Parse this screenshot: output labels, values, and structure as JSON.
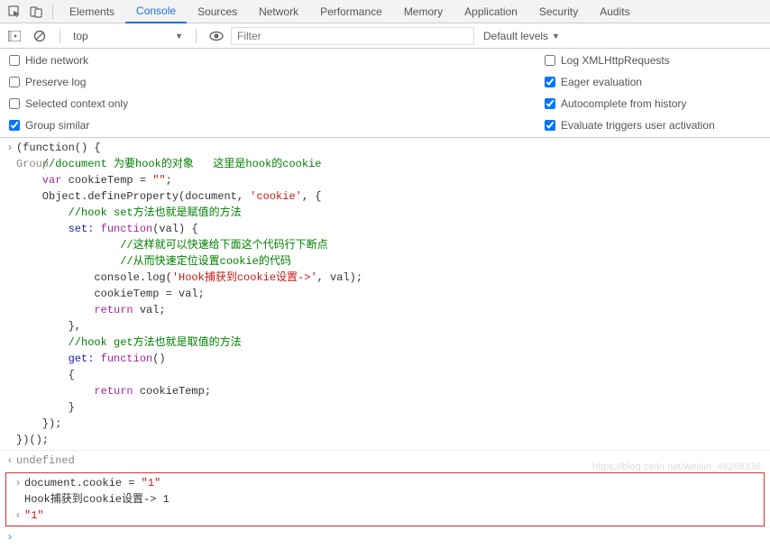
{
  "tabs": {
    "elements": "Elements",
    "console": "Console",
    "sources": "Sources",
    "network": "Network",
    "performance": "Performance",
    "memory": "Memory",
    "application": "Application",
    "security": "Security",
    "audits": "Audits"
  },
  "context": {
    "selected": "top"
  },
  "filter": {
    "placeholder": "Filter"
  },
  "levels": {
    "label": "Default levels"
  },
  "options_left": {
    "hide_network": "Hide network",
    "preserve_log": "Preserve log",
    "selected_context": "Selected context only",
    "group_similar": "Group similar"
  },
  "options_right": {
    "log_xhr": "Log XMLHttpRequests",
    "eager_eval": "Eager evaluation",
    "autocomplete": "Autocomplete from history",
    "evaluate_triggers": "Evaluate triggers user activation"
  },
  "code": {
    "l1": "(function() {",
    "l2_pre": "    ",
    "l2_com": "//document 为要hook的对象   这里是hook的cookie",
    "l2_ghost": "Group",
    "l3a": "    var",
    "l3b": " cookieTemp = ",
    "l3c": "\"\"",
    "l3d": ";",
    "l4a": "    Object.defineProperty(document, ",
    "l4b": "'cookie'",
    "l4c": ", {",
    "l5": "        //hook set方法也就是赋值的方法",
    "l6a": "        set: ",
    "l6b": "function",
    "l6c": "(val) {",
    "l7": "                //这样就可以快速给下面这个代码行下断点",
    "l8": "                //从而快速定位设置cookie的代码",
    "l9a": "            console.log(",
    "l9b": "'Hook捕获到cookie设置->'",
    "l9c": ", val);",
    "l10": "            cookieTemp = val;",
    "l11a": "            return",
    "l11b": " val;",
    "l12": "        },",
    "l13": "        //hook get方法也就是取值的方法",
    "l14a": "        get: ",
    "l14b": "function",
    "l14c": "()",
    "l15": "        {",
    "l16a": "            return",
    "l16b": " cookieTemp;",
    "l17": "        }",
    "l18": "    });",
    "l19": "})();",
    "undefined": "undefined",
    "r1a": "document.cookie = ",
    "r1b": "\"1\"",
    "r2": "Hook捕获到cookie设置-> 1",
    "r3": "\"1\""
  },
  "watermark": "https://blog.csdn.net/weixin_48268336"
}
